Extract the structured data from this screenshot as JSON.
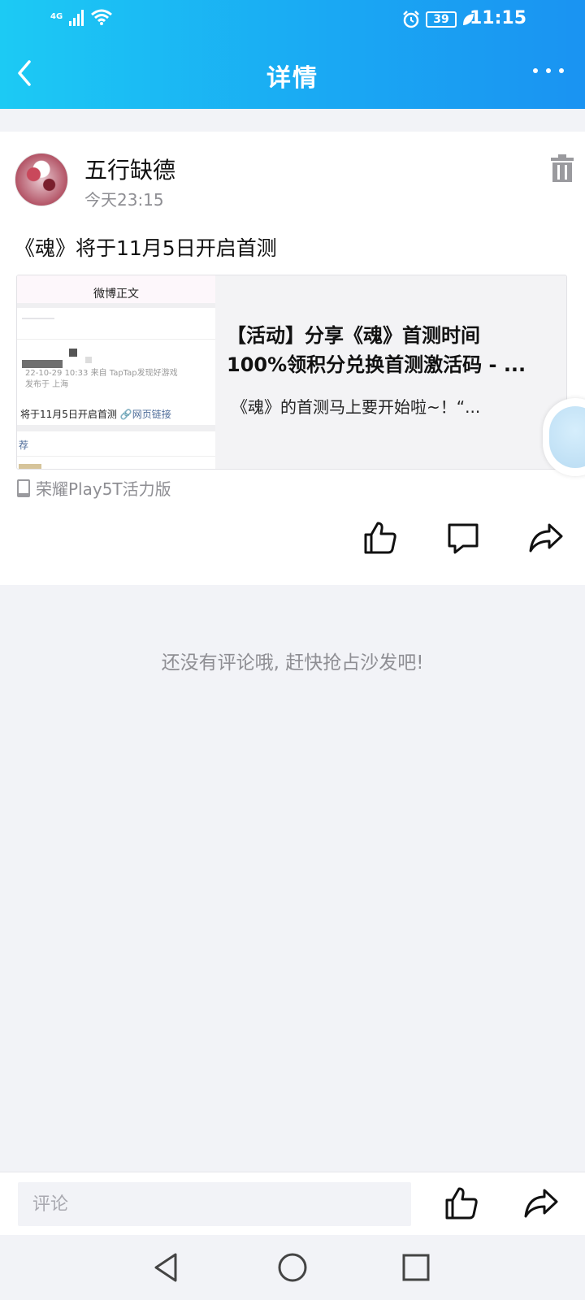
{
  "status_bar": {
    "network": "4G",
    "battery": "39",
    "time": "11:15"
  },
  "nav": {
    "title": "详情",
    "back_icon": "chevron-left-icon",
    "more_icon": "more-horizontal-icon"
  },
  "post": {
    "username": "五行缺德",
    "time": "今天23:15",
    "text": "《魂》将于11月5日开启首测",
    "link_card": {
      "thumbnail": {
        "header": "微博正文",
        "meta_line1": "22-10-29 10:33  来自 TapTap发现好游戏",
        "meta_line2": "发布于 上海",
        "body_text": "将于11月5日开启首测",
        "body_link": "网页链接",
        "rec_label": "荐"
      },
      "title_line1": "【活动】分享《魂》首测时间",
      "title_line2": "100%领积分兑换首测激活码 - ...",
      "description": "《魂》的首测马上要开始啦~！“..."
    },
    "device": "荣耀Play5T活力版"
  },
  "comments": {
    "empty_text": "还没有评论哦, 赶快抢占沙发吧!"
  },
  "bottom_bar": {
    "comment_placeholder": "评论"
  },
  "colors": {
    "header_gradient_start": "#1ccaf4",
    "header_gradient_end": "#1a93f2",
    "page_background": "#f2f3f7",
    "muted_text": "#8e8e93"
  }
}
